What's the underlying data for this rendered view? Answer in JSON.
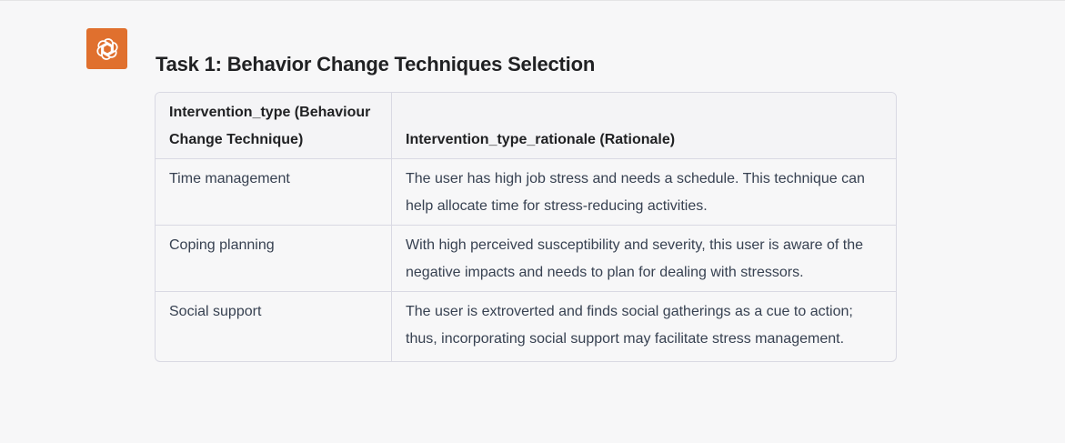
{
  "avatar": {
    "icon": "openai-logo-icon",
    "color": "#e0702e"
  },
  "title": "Task 1: Behavior Change Techniques Selection",
  "table": {
    "headers": [
      "Intervention_type (Behaviour Change Technique)",
      "Intervention_type_rationale (Rationale)"
    ],
    "rows": [
      {
        "technique": "Time management",
        "rationale": "The user has high job stress and needs a schedule. This technique can help allocate time for stress-reducing activities."
      },
      {
        "technique": "Coping planning",
        "rationale": "With high perceived susceptibility and severity, this user is aware of the negative impacts and needs to plan for dealing with stressors."
      },
      {
        "technique": "Social support",
        "rationale": "The user is extroverted and finds social gatherings as a cue to action; thus, incorporating social support may facilitate stress management."
      }
    ]
  }
}
